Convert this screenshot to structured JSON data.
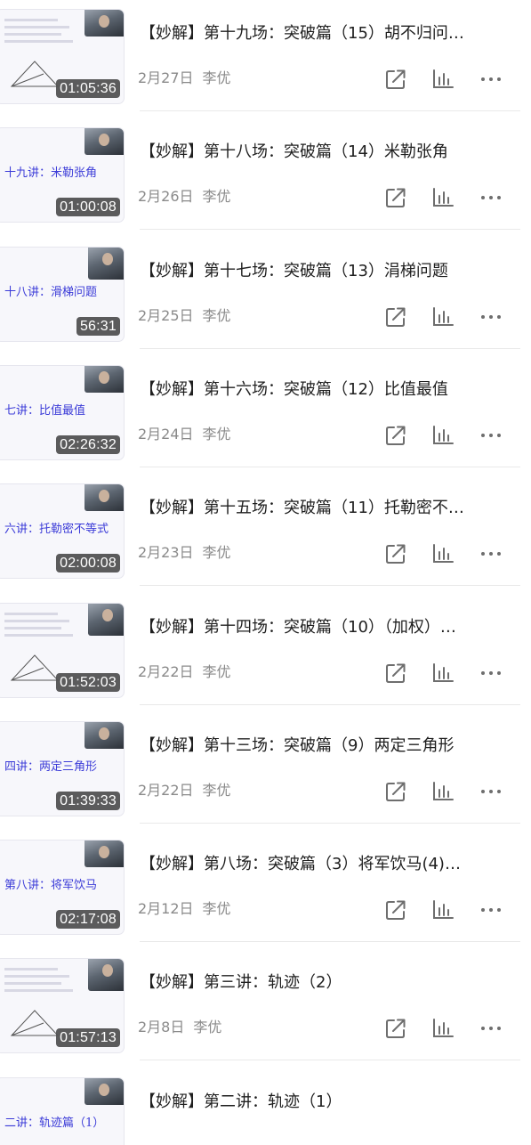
{
  "videos": [
    {
      "title": "【妙解】第十九场：突破篇（15）胡不归问…",
      "date": "2月27日",
      "author": "李优",
      "duration": "01:05:36",
      "thumb_text": ""
    },
    {
      "title": "【妙解】第十八场：突破篇（14）米勒张角",
      "date": "2月26日",
      "author": "李优",
      "duration": "01:00:08",
      "thumb_text": "十九讲：米勒张角"
    },
    {
      "title": "【妙解】第十七场：突破篇（13）涓梯问题",
      "date": "2月25日",
      "author": "李优",
      "duration": "56:31",
      "thumb_text": "十八讲：滑梯问题"
    },
    {
      "title": "【妙解】第十六场：突破篇（12）比值最值",
      "date": "2月24日",
      "author": "李优",
      "duration": "02:26:32",
      "thumb_text": "七讲：比值最值"
    },
    {
      "title": "【妙解】第十五场：突破篇（11）托勒密不…",
      "date": "2月23日",
      "author": "李优",
      "duration": "02:00:08",
      "thumb_text": "六讲：托勒密不等式"
    },
    {
      "title": "【妙解】第十四场：突破篇（10）（加权）…",
      "date": "2月22日",
      "author": "李优",
      "duration": "01:52:03",
      "thumb_text": ""
    },
    {
      "title": "【妙解】第十三场：突破篇（9）两定三角形",
      "date": "2月22日",
      "author": "李优",
      "duration": "01:39:33",
      "thumb_text": "四讲：两定三角形"
    },
    {
      "title": "【妙解】第八场：突破篇（3）将军饮马(4)…",
      "date": "2月12日",
      "author": "李优",
      "duration": "02:17:08",
      "thumb_text": "第八讲：将军饮马"
    },
    {
      "title": "【妙解】第三讲：轨迹（2）",
      "date": "2月8日",
      "author": "李优",
      "duration": "01:57:13",
      "thumb_text": ""
    },
    {
      "title": "【妙解】第二讲：轨迹（1）",
      "date": "",
      "author": "",
      "duration": "",
      "thumb_text": "二讲：轨迹篇（1）"
    }
  ],
  "icons": {
    "share": "share-external-icon",
    "stats": "bar-chart-icon",
    "more": "more-dots-icon"
  },
  "colors": {
    "title": "#1f1f1f",
    "meta": "#8a8a8a",
    "icon": "#6e6e6e",
    "duration_bg": "#1e1e1e",
    "slide_text": "#3c3cd8"
  }
}
